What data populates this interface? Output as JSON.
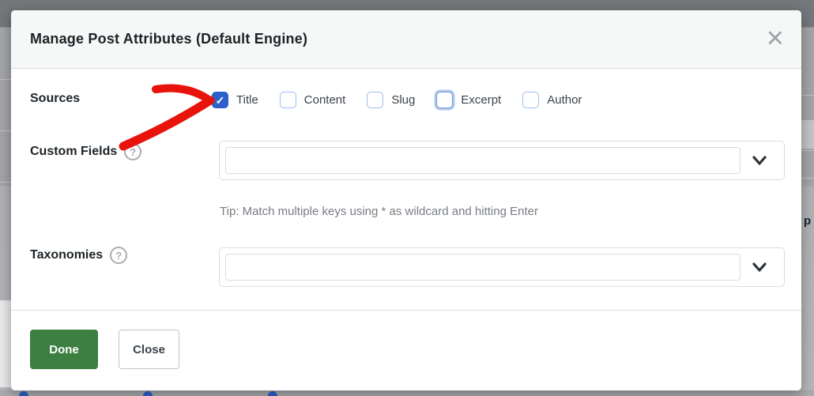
{
  "modal": {
    "title": "Manage Post Attributes (Default Engine)",
    "sources": {
      "label": "Sources",
      "options": [
        {
          "label": "Title",
          "checked": true,
          "focused": false
        },
        {
          "label": "Content",
          "checked": false,
          "focused": false
        },
        {
          "label": "Slug",
          "checked": false,
          "focused": false
        },
        {
          "label": "Excerpt",
          "checked": false,
          "focused": true
        },
        {
          "label": "Author",
          "checked": false,
          "focused": false
        }
      ]
    },
    "custom_fields": {
      "label": "Custom Fields",
      "input_value": "",
      "tip": "Tip: Match multiple keys using * as wildcard and hitting Enter"
    },
    "taxonomies": {
      "label": "Taxonomies",
      "input_value": ""
    },
    "footer": {
      "done_label": "Done",
      "close_label": "Close"
    }
  },
  "icons": {
    "close": "×",
    "check": "✓",
    "help": "?"
  },
  "background_page": {
    "partial_text": "p"
  },
  "colors": {
    "accent_blue": "#2b61c9",
    "done_green": "#3d7e41",
    "arrow_red": "#e8140c"
  }
}
